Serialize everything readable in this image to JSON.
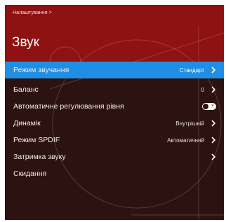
{
  "header": {
    "breadcrumb": "Налаштування >",
    "title": "Звук"
  },
  "menu": [
    {
      "label": "Режим звучання",
      "value": "Стандарт",
      "control": "chevron",
      "selected": true
    },
    {
      "label": "Баланс",
      "value": "0",
      "control": "chevron",
      "selected": false
    },
    {
      "label": "Автоматичне регулювання рівня",
      "value": "",
      "control": "toggle",
      "toggle_on": false,
      "toggle_glyph": "×",
      "selected": false
    },
    {
      "label": "Динамік",
      "value": "Внутрішній",
      "control": "chevron",
      "selected": false
    },
    {
      "label": "Режим SPDIF",
      "value": "Автоматичний",
      "control": "chevron",
      "selected": false
    },
    {
      "label": "Затримка звуку",
      "value": "",
      "control": "chevron",
      "selected": false
    },
    {
      "label": "Скидання",
      "value": "",
      "control": "none",
      "selected": false
    }
  ],
  "colors": {
    "header_bg": "#8e1212",
    "panel_bg": "#2c1210",
    "selected_bg": "#1f8fe6",
    "text": "#f1ecea"
  }
}
